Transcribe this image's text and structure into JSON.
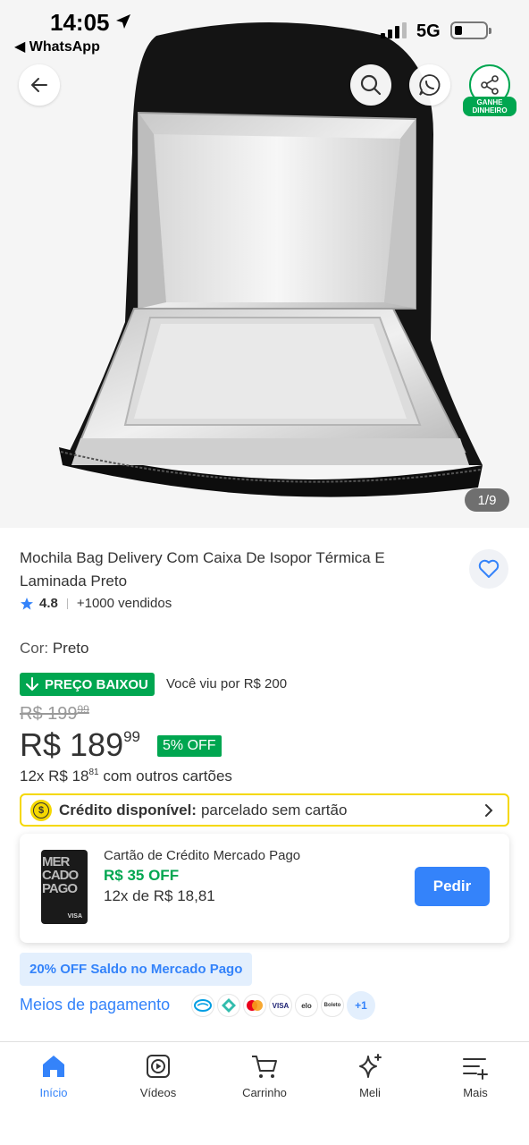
{
  "status_bar": {
    "time": "14:05",
    "back_app": "◀ WhatsApp",
    "network": "5G"
  },
  "hero": {
    "counter": "1/9",
    "share_badge": "GANHE DINHEIRO"
  },
  "product": {
    "title": "Mochila Bag Delivery Com Caixa De Isopor Térmica E Laminada Preto",
    "rating": "4.8",
    "sold": "+1000 vendidos",
    "color_label": "Cor: ",
    "color_value": "Preto",
    "price_drop_label": "PREÇO BAIXOU",
    "seen_text": "Você viu por R$ 200",
    "old_price_int": "R$ 199",
    "old_price_cents": "99",
    "price_int": "R$ 189",
    "price_cents": "99",
    "discount": "5% OFF",
    "installments_prefix": "12x R$ 18",
    "installments_cents": "81",
    "installments_suffix": " com outros cartões"
  },
  "credit": {
    "bold": "Crédito disponível:",
    "rest": "parcelado sem cartão"
  },
  "card_offer": {
    "card_text": "MER\nCADO\nPAGO",
    "card_brand": "VISA",
    "title": "Cartão de Crédito Mercado Pago",
    "off": "R$ 35 OFF",
    "installments": "12x de R$ 18,81",
    "button": "Pedir"
  },
  "saldo_badge": "20% OFF Saldo no Mercado Pago",
  "payment": {
    "label": "Meios de pagamento",
    "visa": "VISA",
    "elo": "elo",
    "boleto": "Boleto",
    "more": "+1"
  },
  "nav": {
    "items": [
      {
        "label": "Início",
        "icon": "home-icon"
      },
      {
        "label": "Vídeos",
        "icon": "video-icon"
      },
      {
        "label": "Carrinho",
        "icon": "cart-icon"
      },
      {
        "label": "Meli",
        "icon": "sparkle-icon"
      },
      {
        "label": "Mais",
        "icon": "menu-add-icon"
      }
    ]
  },
  "colors": {
    "green": "#00a650",
    "blue": "#3483fa",
    "yellow": "#f5d800"
  }
}
